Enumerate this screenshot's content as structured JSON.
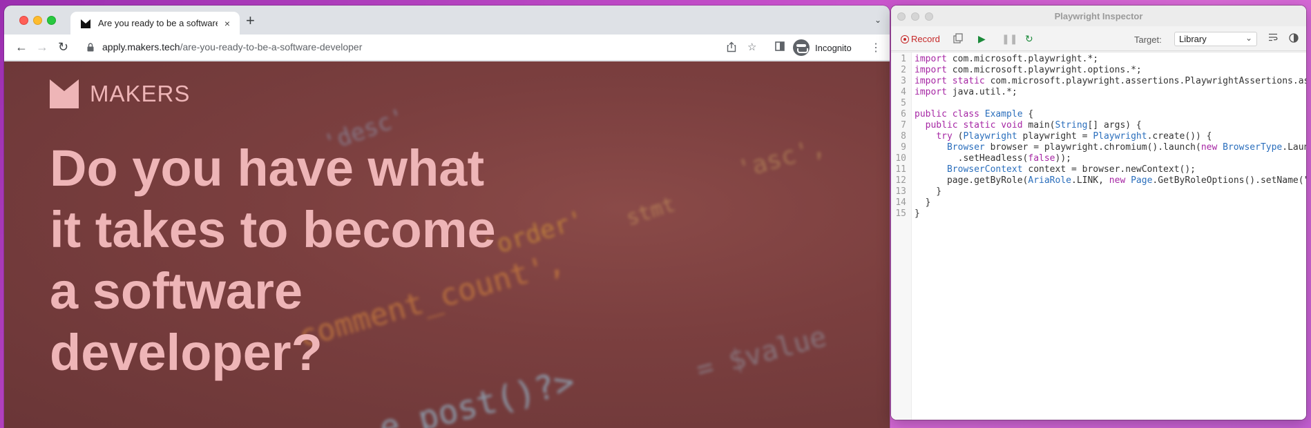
{
  "browser": {
    "tab_title": "Are you ready to be a software developer",
    "tab_close": "×",
    "new_tab": "+",
    "url_host": "apply.makers.tech",
    "url_path": "/are-you-ready-to-be-a-software-developer",
    "incognito_label": "Incognito"
  },
  "page": {
    "logo_text": "MAKERS",
    "headline": "Do you have what it takes to become a software developer?",
    "background_code": [
      "comment_count',",
      "'order'",
      "e_post()?>",
      "stmt",
      "'desc'",
      "'asc',",
      "= $value"
    ]
  },
  "inspector": {
    "title": "Playwright Inspector",
    "record_label": "Record",
    "target_label": "Target:",
    "target_value": "Library",
    "code_lines": [
      [
        [
          "kw",
          "import "
        ],
        [
          "pl",
          "com.microsoft.playwright.*;"
        ]
      ],
      [
        [
          "kw",
          "import "
        ],
        [
          "pl",
          "com.microsoft.playwright.options.*;"
        ]
      ],
      [
        [
          "kw",
          "import static "
        ],
        [
          "pl",
          "com.microsoft.playwright.assertions.PlaywrightAssertions.assertThat;"
        ]
      ],
      [
        [
          "kw",
          "import "
        ],
        [
          "pl",
          "java.util.*;"
        ]
      ],
      [],
      [
        [
          "kw",
          "public class "
        ],
        [
          "ty",
          "Example"
        ],
        [
          "pl",
          " {"
        ]
      ],
      [
        [
          "pl",
          "  "
        ],
        [
          "kw",
          "public static void "
        ],
        [
          "pl",
          "main("
        ],
        [
          "ty",
          "String"
        ],
        [
          "pl",
          "[] args) {"
        ]
      ],
      [
        [
          "pl",
          "    "
        ],
        [
          "kw",
          "try "
        ],
        [
          "pl",
          "("
        ],
        [
          "ty",
          "Playwright"
        ],
        [
          "pl",
          " playwright = "
        ],
        [
          "ty",
          "Playwright"
        ],
        [
          "pl",
          ".create()) {"
        ]
      ],
      [
        [
          "pl",
          "      "
        ],
        [
          "ty",
          "Browser"
        ],
        [
          "pl",
          " browser = playwright.chromium().launch("
        ],
        [
          "kw",
          "new "
        ],
        [
          "ty",
          "BrowserType"
        ],
        [
          "pl",
          ".LaunchOptions()"
        ]
      ],
      [
        [
          "pl",
          "        .setHeadless("
        ],
        [
          "kw",
          "false"
        ],
        [
          "pl",
          "));"
        ]
      ],
      [
        [
          "pl",
          "      "
        ],
        [
          "ty",
          "BrowserContext"
        ],
        [
          "pl",
          " context = browser.newContext();"
        ]
      ],
      [
        [
          "pl",
          "      page.getByRole("
        ],
        [
          "ty",
          "AriaRole"
        ],
        [
          "pl",
          ".LINK, "
        ],
        [
          "kw",
          "new "
        ],
        [
          "ty",
          "Page"
        ],
        [
          "pl",
          ".GetByRoleOptions().setName(\"Cookie settings\"));"
        ]
      ],
      [
        [
          "pl",
          "    }"
        ]
      ],
      [
        [
          "pl",
          "  }"
        ]
      ],
      [
        [
          "pl",
          "}"
        ]
      ]
    ]
  }
}
